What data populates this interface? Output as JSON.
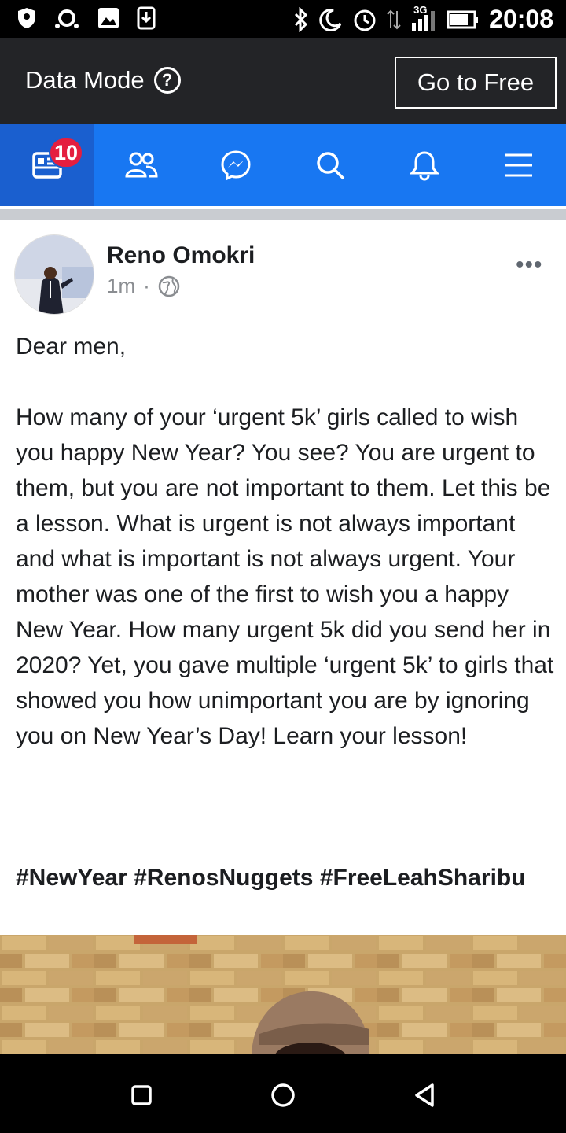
{
  "status_bar": {
    "time": "20:08",
    "network": "3G",
    "icons": [
      "shield-icon",
      "record-icon",
      "image-icon",
      "download-icon",
      "bluetooth-icon",
      "moon-icon",
      "alarm-icon",
      "data-transfer-icon",
      "signal-icon",
      "battery-icon"
    ]
  },
  "data_bar": {
    "label": "Data Mode",
    "help": "?",
    "cta": "Go to Free"
  },
  "nav": {
    "badge": "10",
    "tabs": [
      "news-feed-icon",
      "friends-icon",
      "messenger-icon",
      "search-icon",
      "notifications-icon",
      "menu-icon"
    ],
    "colors": {
      "bar": "#1877f2",
      "active": "#1a5fcf",
      "badge": "#e41e3f"
    }
  },
  "post": {
    "author": "Reno Omokri",
    "time": "1m",
    "separator": "·",
    "privacy_icon": "globe-icon",
    "more": "•••",
    "body": "Dear men,\n\nHow many of your ‘urgent 5k’ girls called to wish you happy New Year? You see? You are urgent to them, but you are not important to them. Let this be a lesson. What is urgent is not always important and what is important is not always urgent. Your mother was one of the first to wish you a happy New Year. How many urgent 5k did you send her in 2020? Yet, you gave multiple ‘urgent 5k’ to girls that showed you how unimportant you are by ignoring you on New Year’s Day! Learn your lesson!",
    "hashtags": "#NewYear #RenosNuggets #FreeLeahSharibu"
  },
  "system_nav": [
    "recent-apps-button",
    "home-button",
    "back-button"
  ]
}
